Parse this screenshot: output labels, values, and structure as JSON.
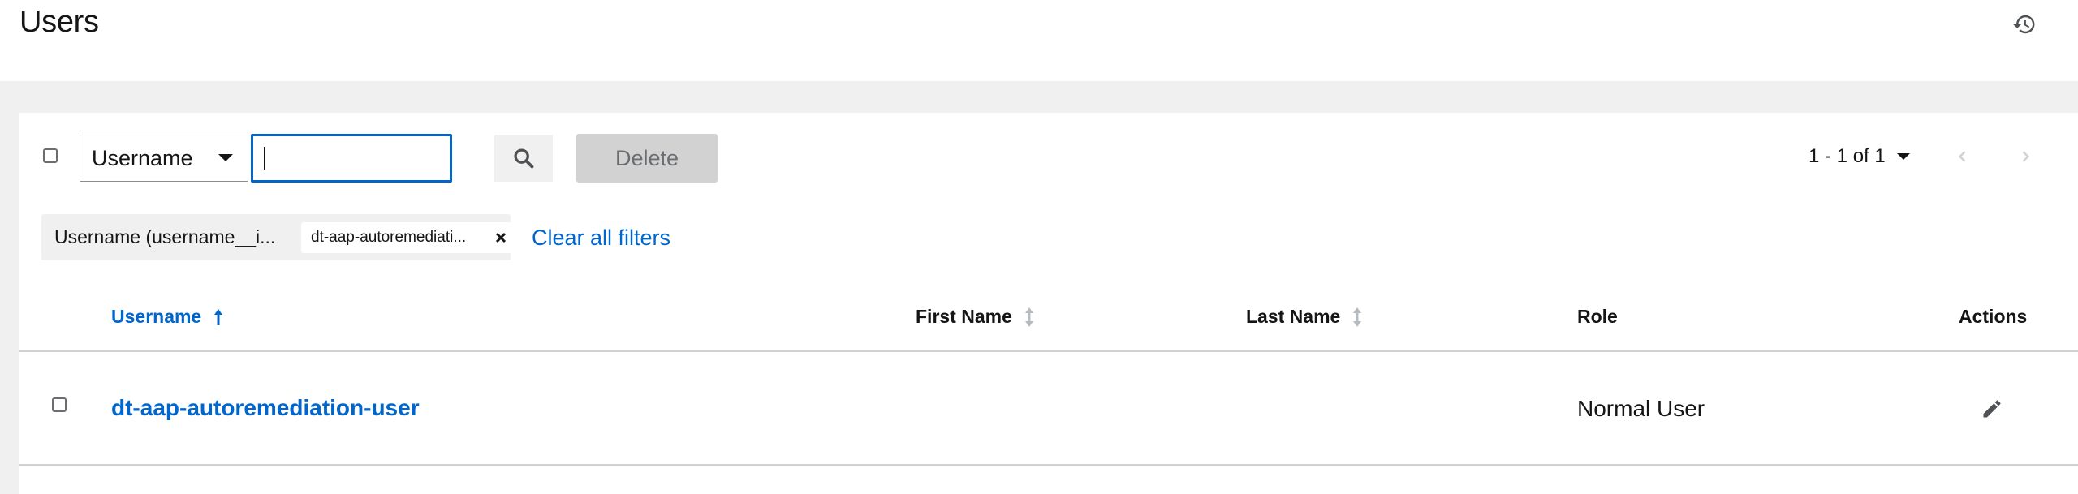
{
  "header": {
    "title": "Users",
    "history_icon": "history-icon"
  },
  "toolbar": {
    "filter_type": "Username",
    "search_value": "",
    "search_icon": "search-icon",
    "delete_label": "Delete",
    "pagination_range": "1 - 1 of 1",
    "prev_icon": "chevron-left-icon",
    "next_icon": "chevron-right-icon"
  },
  "filters": {
    "category": "Username (username__i...",
    "chip_label": "dt-aap-autoremediati...",
    "clear_label": "Clear all filters"
  },
  "table": {
    "columns": [
      {
        "label": "Username",
        "sort": "ascending"
      },
      {
        "label": "First Name",
        "sort": "none"
      },
      {
        "label": "Last Name",
        "sort": "none"
      },
      {
        "label": "Role",
        "sort": null
      },
      {
        "label": "Actions",
        "sort": null
      }
    ],
    "rows": [
      {
        "username": "dt-aap-autoremediation-user",
        "first_name": "",
        "last_name": "",
        "role": "Normal User",
        "action_icon": "pencil-icon"
      }
    ]
  },
  "colors": {
    "accent": "#0066cc",
    "text": "#151515",
    "muted": "#6a6e73",
    "background": "#f0f0f0"
  }
}
